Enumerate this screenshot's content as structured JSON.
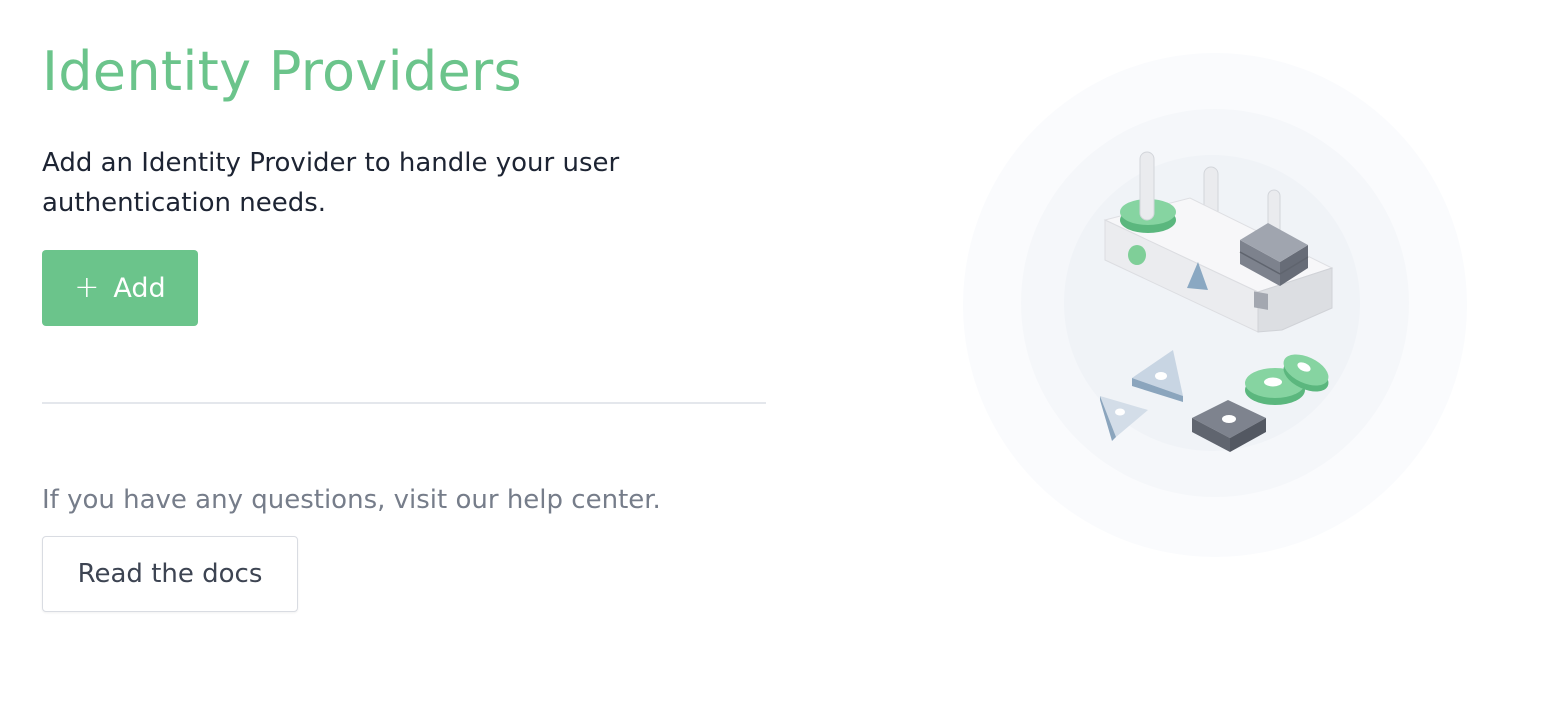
{
  "header": {
    "title": "Identity Providers"
  },
  "main": {
    "description": "Add an Identity Provider to handle your user authentication needs.",
    "add_button": {
      "icon": "plus-icon",
      "label": "Add"
    }
  },
  "help": {
    "text": "If you have any questions, visit our help center.",
    "docs_button": "Read the docs"
  },
  "illustration": {
    "name": "shape-sorter-toy"
  },
  "colors": {
    "accent": "#6bc48b",
    "text_dark": "#1d2433",
    "text_muted": "#767d8a",
    "divider": "#e4e7ec"
  }
}
